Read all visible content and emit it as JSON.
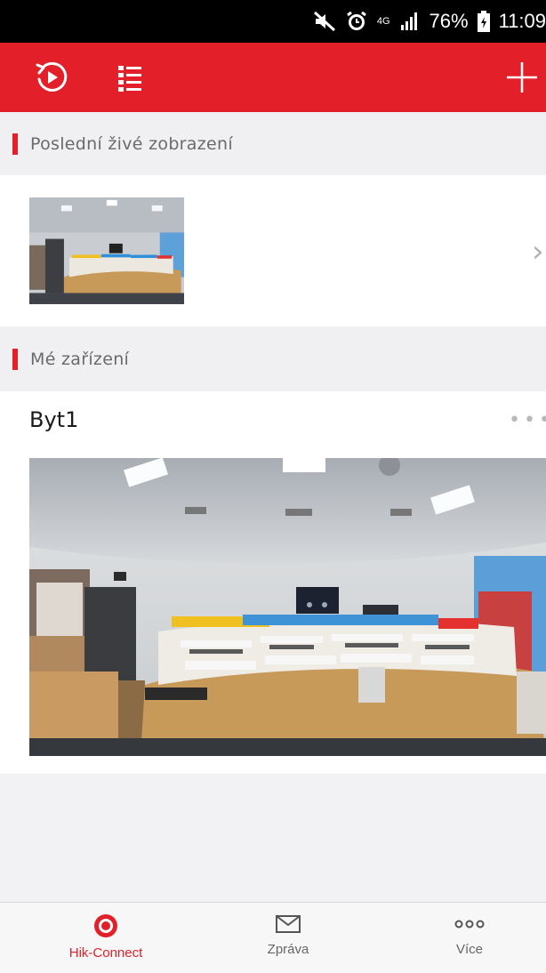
{
  "status_bar": {
    "network": "4G",
    "battery": "76%",
    "time": "11:09",
    "icons": [
      "mute-icon",
      "alarm-icon",
      "signal-icon",
      "battery-icon"
    ]
  },
  "app_bar": {
    "left_icons": [
      "playback-icon",
      "list-view-icon"
    ],
    "right_icon": "add-icon",
    "color": "#e3202a"
  },
  "recent": {
    "header": "Poslední živé zobrazení",
    "thumbnail": "camera-snapshot"
  },
  "devices": {
    "header": "Mé zařízení",
    "items": [
      {
        "name": "Byt1",
        "menu_icon": "more-dots-icon",
        "preview": "live-camera-preview"
      }
    ]
  },
  "tabs": [
    {
      "label": "Hik-Connect",
      "icon": "hik-connect-icon",
      "active": true
    },
    {
      "label": "Zpráva",
      "icon": "envelope-icon",
      "active": false
    },
    {
      "label": "Více",
      "icon": "more-icon",
      "active": false
    }
  ],
  "colors": {
    "accent": "#e3202a",
    "background": "#f2f2f4"
  }
}
